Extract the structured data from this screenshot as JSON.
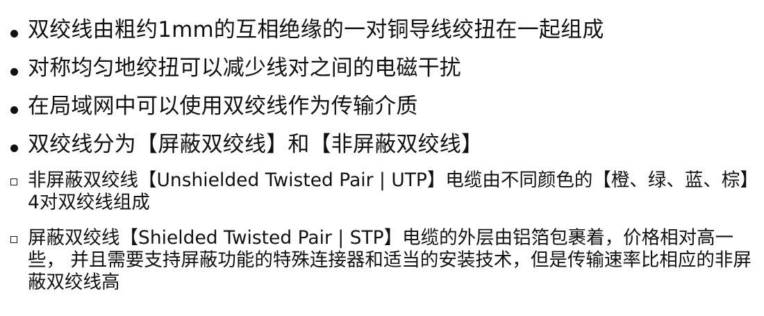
{
  "bullets": [
    {
      "level": 1,
      "marker": "dot",
      "text": "双绞线由粗约1mm的互相绝缘的一对铜导线绞扭在一起组成"
    },
    {
      "level": 1,
      "marker": "dot",
      "text": "对称均匀地绞扭可以减少线对之间的电磁干扰"
    },
    {
      "level": 1,
      "marker": "dot",
      "text": "在局域网中可以使用双绞线作为传输介质"
    },
    {
      "level": 1,
      "marker": "dot",
      "text": "双绞线分为【屏蔽双绞线】和【非屏蔽双绞线】"
    },
    {
      "level": 2,
      "marker": "square",
      "text": "非屏蔽双绞线【Unshielded Twisted Pair | UTP】电缆由不同颜色的【橙、绿、蓝、棕】4对双绞线组成"
    },
    {
      "level": 2,
      "marker": "square",
      "text": "屏蔽双绞线【Shielded Twisted Pair | STP】电缆的外层由铝箔包裹着，价格相对高一些， 并且需要支持屏蔽功能的特殊连接器和适当的安装技术，但是传输速率比相应的非屏蔽双绞线高"
    }
  ],
  "colors": {
    "text": "#111111",
    "background": "#ffffff"
  }
}
